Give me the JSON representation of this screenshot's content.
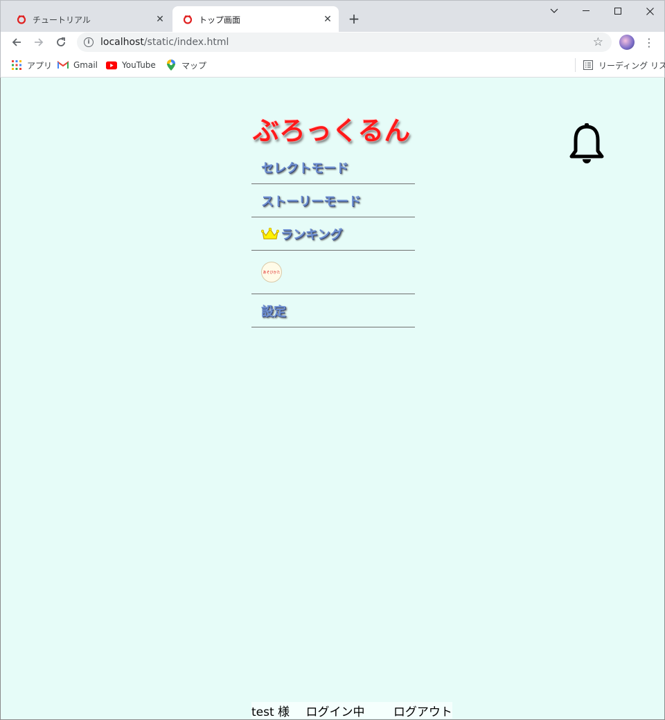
{
  "browser": {
    "tabs": [
      {
        "title": "チュートリアル",
        "active": false
      },
      {
        "title": "トップ画面",
        "active": true
      }
    ],
    "url_host": "localhost",
    "url_path": "/static/index.html",
    "bookmarks": [
      {
        "label": "アプリ",
        "icon": "apps-grid-icon"
      },
      {
        "label": "Gmail",
        "icon": "gmail-icon"
      },
      {
        "label": "YouTube",
        "icon": "youtube-icon"
      },
      {
        "label": "マップ",
        "icon": "maps-pin-icon"
      }
    ],
    "reading_list": "リーディング リスト",
    "colors": {
      "tabstrip": "#dee1e6",
      "omnibox": "#f1f3f4"
    }
  },
  "page": {
    "logo_text": "ぶろっくるん",
    "menu": [
      {
        "label": "セレクトモード"
      },
      {
        "label": "ストーリーモード"
      },
      {
        "label": "ランキング"
      },
      {
        "label": "あそびかた"
      },
      {
        "label": "設定"
      }
    ],
    "footer": {
      "user": "test 様",
      "status": "ログイン中",
      "logout": "ログアウト"
    },
    "colors": {
      "background": "#e6fcf8",
      "logo": "#ff1a1a",
      "menu_text": "#6e8fd2"
    }
  }
}
